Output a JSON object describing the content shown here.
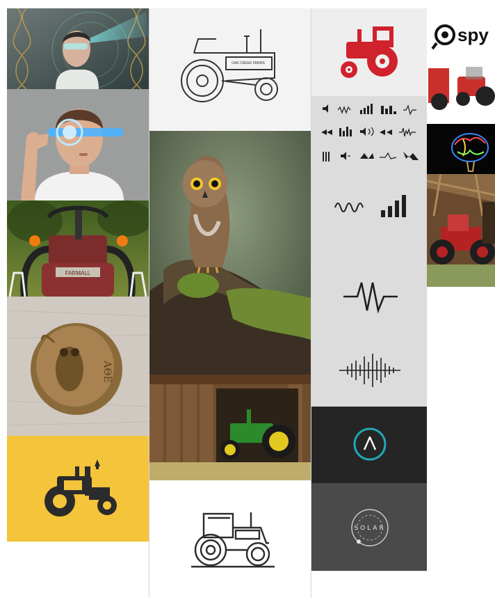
{
  "tiles": [
    {
      "id": "vr-man-hologram",
      "icon": "vr-man-icon"
    },
    {
      "id": "man-smart-glasses",
      "icon": "smart-glasses-icon"
    },
    {
      "id": "red-tractor-photo",
      "icon": "tractor-photo-icon",
      "text": "FARMALL"
    },
    {
      "id": "owl-coin",
      "icon": "owl-coin-icon",
      "text": "ΑΘΕ"
    },
    {
      "id": "yellow-tractor-logo",
      "icon": "tractor-icon",
      "color": "#F4C43A"
    },
    {
      "id": "tractor-line-drawing",
      "icon": "tractor-outline-icon"
    },
    {
      "id": "owl-photo",
      "icon": "owl-icon"
    },
    {
      "id": "green-tractor-barn",
      "icon": "barn-tractor-icon"
    },
    {
      "id": "tractor-outline-logo",
      "icon": "tractor-outline-icon"
    },
    {
      "id": "red-tractor-illustration",
      "icon": "tractor-icon",
      "color": "#D0222C"
    },
    {
      "id": "audio-wave-icons",
      "icon": "sound-wave-icon"
    },
    {
      "id": "circle-a-logo",
      "icon": "circle-a-icon",
      "color": "#22A7B5"
    },
    {
      "id": "solar-logo",
      "icon": "solar-logo-icon",
      "text": "SOLAR"
    },
    {
      "id": "spy-tractor-ad",
      "icon": "spy-logo-icon",
      "text": "spy"
    },
    {
      "id": "neon-brain",
      "icon": "brain-icon"
    },
    {
      "id": "red-tractor-shed",
      "icon": "shed-tractor-icon"
    }
  ],
  "texts": {
    "spy_logo": "spy",
    "solar_logo": "SOLAR",
    "coin_letters": "ΑΘΕ",
    "tractor_badge": "FARMALL",
    "drawing_hood_text": "OAK CREEK FARMS"
  },
  "colors": {
    "yellow": "#F4C43A",
    "red_tractor": "#D0222C",
    "teal": "#22A7B5",
    "dark_tile": "#252525",
    "gray_tile": "#4a4a4a",
    "icon_bg": "#dcdcdc"
  }
}
